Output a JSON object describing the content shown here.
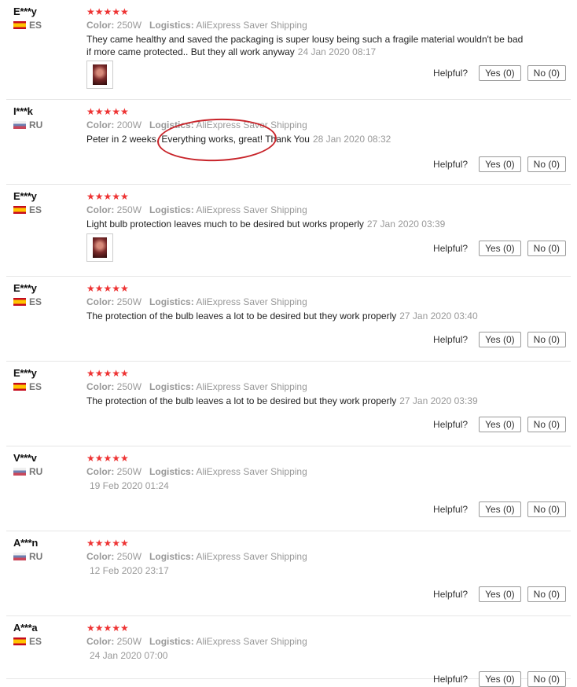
{
  "helpful_label": "Helpful?",
  "colors": {
    "star": "#ee3333",
    "annotation": "#c8242a"
  },
  "reviews": [
    {
      "user": "E***y",
      "country": "ES",
      "flag": "es",
      "stars": "★★★★★",
      "color_label": "Color:",
      "color": "250W",
      "logistics_label": "Logistics:",
      "logistics": "AliExpress Saver Shipping",
      "text": "They came healthy and saved the packaging is super lousy being such a fragile material wouldn't be bad if more came protected.. But they all work anyway",
      "date": "24 Jan 2020 08:17",
      "has_image": true,
      "yes": "Yes (0)",
      "no": "No (0)"
    },
    {
      "user": "I***k",
      "country": "RU",
      "flag": "ru",
      "stars": "★★★★★",
      "color_label": "Color:",
      "color": "200W",
      "logistics_label": "Logistics:",
      "logistics": "AliExpress Saver Shipping",
      "text": "Peter in 2 weeks. Everything works, great! Thank You",
      "date": "28 Jan 2020 08:32",
      "has_image": false,
      "yes": "Yes (0)",
      "no": "No (0)"
    },
    {
      "user": "E***y",
      "country": "ES",
      "flag": "es",
      "stars": "★★★★★",
      "color_label": "Color:",
      "color": "250W",
      "logistics_label": "Logistics:",
      "logistics": "AliExpress Saver Shipping",
      "text": "Light bulb protection leaves much to be desired but works properly",
      "date": "27 Jan 2020 03:39",
      "has_image": true,
      "yes": "Yes (0)",
      "no": "No (0)"
    },
    {
      "user": "E***y",
      "country": "ES",
      "flag": "es",
      "stars": "★★★★★",
      "color_label": "Color:",
      "color": "250W",
      "logistics_label": "Logistics:",
      "logistics": "AliExpress Saver Shipping",
      "text": "The protection of the bulb leaves a lot to be desired but they work properly",
      "date": "27 Jan 2020 03:40",
      "has_image": false,
      "yes": "Yes (0)",
      "no": "No (0)"
    },
    {
      "user": "E***y",
      "country": "ES",
      "flag": "es",
      "stars": "★★★★★",
      "color_label": "Color:",
      "color": "250W",
      "logistics_label": "Logistics:",
      "logistics": "AliExpress Saver Shipping",
      "text": "The protection of the bulb leaves a lot to be desired but they work properly",
      "date": "27 Jan 2020 03:39",
      "has_image": false,
      "yes": "Yes (0)",
      "no": "No (0)"
    },
    {
      "user": "V***v",
      "country": "RU",
      "flag": "ru",
      "stars": "★★★★★",
      "color_label": "Color:",
      "color": "250W",
      "logistics_label": "Logistics:",
      "logistics": "AliExpress Saver Shipping",
      "text": "",
      "date": "19 Feb 2020 01:24",
      "has_image": false,
      "yes": "Yes (0)",
      "no": "No (0)"
    },
    {
      "user": "A***n",
      "country": "RU",
      "flag": "ru",
      "stars": "★★★★★",
      "color_label": "Color:",
      "color": "250W",
      "logistics_label": "Logistics:",
      "logistics": "AliExpress Saver Shipping",
      "text": "",
      "date": "12 Feb 2020 23:17",
      "has_image": false,
      "yes": "Yes (0)",
      "no": "No (0)"
    },
    {
      "user": "A***a",
      "country": "ES",
      "flag": "es",
      "stars": "★★★★★",
      "color_label": "Color:",
      "color": "250W",
      "logistics_label": "Logistics:",
      "logistics": "AliExpress Saver Shipping",
      "text": "",
      "date": "24 Jan 2020 07:00",
      "has_image": false,
      "yes": "Yes (0)",
      "no": "No (0)"
    }
  ]
}
